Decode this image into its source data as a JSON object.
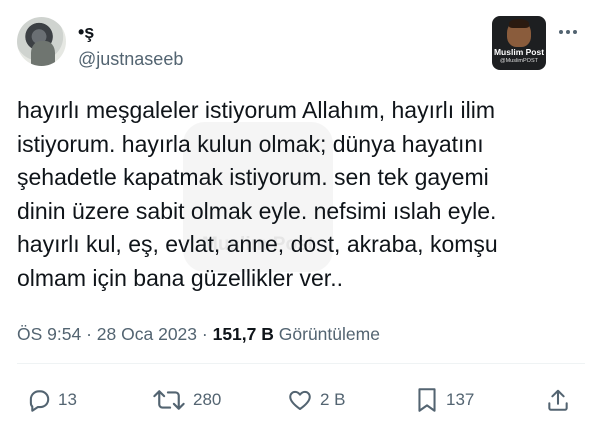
{
  "author": {
    "display_name": "•ş",
    "handle": "@justnaseeb"
  },
  "brand": {
    "name": "Muslim Post",
    "handle": "@MuslimPOST",
    "watermark_text": "Muslim Post"
  },
  "tweet": {
    "text": "hayırlı meşgaleler istiyorum Allahım, hayırlı ilim\nistiyorum. hayırla kulun olmak; dünya hayatını\nşehadetle kapatmak istiyorum. sen tek gayemi\ndinin üzere sabit olmak eyle. nefsimi ıslah eyle.\nhayırlı kul, eş, evlat, anne, dost, akraba, komşu\nolmam için bana güzellikler ver.."
  },
  "meta": {
    "time": "ÖS 9:54",
    "separator": "·",
    "date": "28 Oca 2023",
    "views_count": "151,7 B",
    "views_label": "Görüntüleme"
  },
  "actions": {
    "reply_count": "13",
    "retweet_count": "280",
    "like_count": "2 B",
    "bookmark_count": "137"
  },
  "icons": [
    "more-options-icon",
    "reply-icon",
    "retweet-icon",
    "like-icon",
    "bookmark-icon",
    "share-icon"
  ],
  "colors": {
    "text_primary": "#0f1419",
    "text_secondary": "#536471",
    "divider": "#eff3f4"
  }
}
